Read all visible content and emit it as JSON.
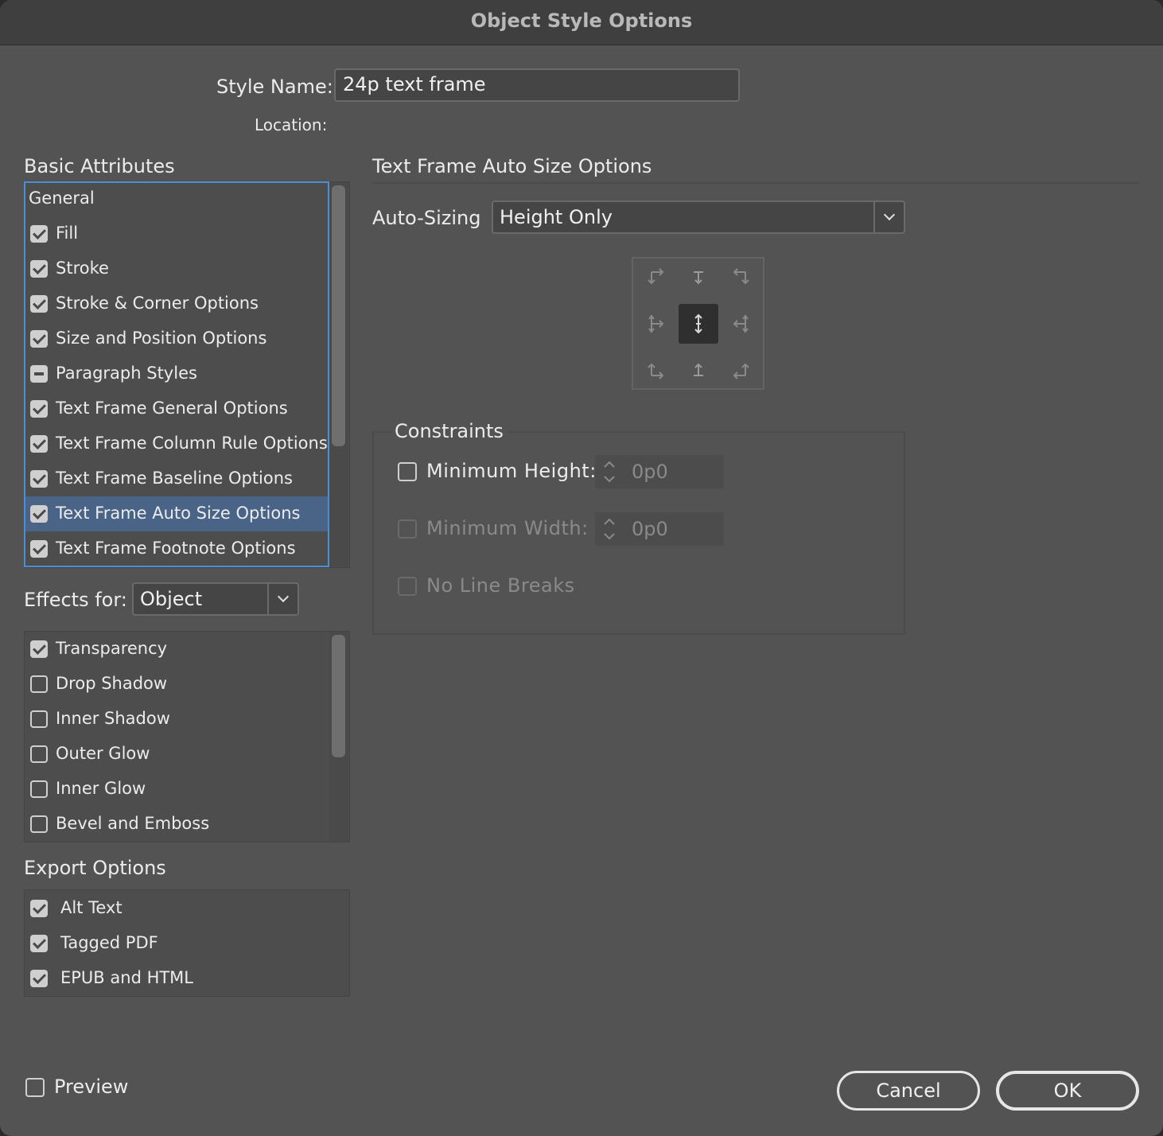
{
  "window": {
    "title": "Object Style Options"
  },
  "header": {
    "style_name_label": "Style Name:",
    "style_name_value": "24p text frame",
    "location_label": "Location:"
  },
  "basic_attributes": {
    "heading": "Basic Attributes",
    "items": [
      {
        "label": "General",
        "state": "none"
      },
      {
        "label": "Fill",
        "state": "checked"
      },
      {
        "label": "Stroke",
        "state": "checked"
      },
      {
        "label": "Stroke & Corner Options",
        "state": "checked"
      },
      {
        "label": "Size and Position Options",
        "state": "checked"
      },
      {
        "label": "Paragraph Styles",
        "state": "mixed"
      },
      {
        "label": "Text Frame General Options",
        "state": "checked"
      },
      {
        "label": "Text Frame Column Rule Options",
        "state": "checked"
      },
      {
        "label": "Text Frame Baseline Options",
        "state": "checked"
      },
      {
        "label": "Text Frame Auto Size Options",
        "state": "checked",
        "selected": true
      },
      {
        "label": "Text Frame Footnote Options",
        "state": "checked"
      }
    ]
  },
  "effects": {
    "label": "Effects for:",
    "selected": "Object",
    "items": [
      {
        "label": "Transparency",
        "state": "checked"
      },
      {
        "label": "Drop Shadow",
        "state": "unchecked"
      },
      {
        "label": "Inner Shadow",
        "state": "unchecked"
      },
      {
        "label": "Outer Glow",
        "state": "unchecked"
      },
      {
        "label": "Inner Glow",
        "state": "unchecked"
      },
      {
        "label": "Bevel and Emboss",
        "state": "unchecked"
      }
    ]
  },
  "export_options": {
    "heading": "Export Options",
    "items": [
      {
        "label": "Alt Text",
        "state": "checked"
      },
      {
        "label": "Tagged PDF",
        "state": "checked"
      },
      {
        "label": "EPUB and HTML",
        "state": "checked"
      }
    ]
  },
  "panel": {
    "heading": "Text Frame Auto Size Options",
    "auto_sizing_label": "Auto-Sizing",
    "auto_sizing_value": "Height Only",
    "reference_point_selected": "center",
    "constraints": {
      "heading": "Constraints",
      "min_height_label": "Minimum Height:",
      "min_height_value": "0p0",
      "min_height_checked": false,
      "min_width_label": "Minimum Width:",
      "min_width_value": "0p0",
      "min_width_enabled": false,
      "no_line_breaks_label": "No Line Breaks",
      "no_line_breaks_enabled": false
    }
  },
  "footer": {
    "preview_label": "Preview",
    "preview_checked": false,
    "cancel_label": "Cancel",
    "ok_label": "OK"
  }
}
